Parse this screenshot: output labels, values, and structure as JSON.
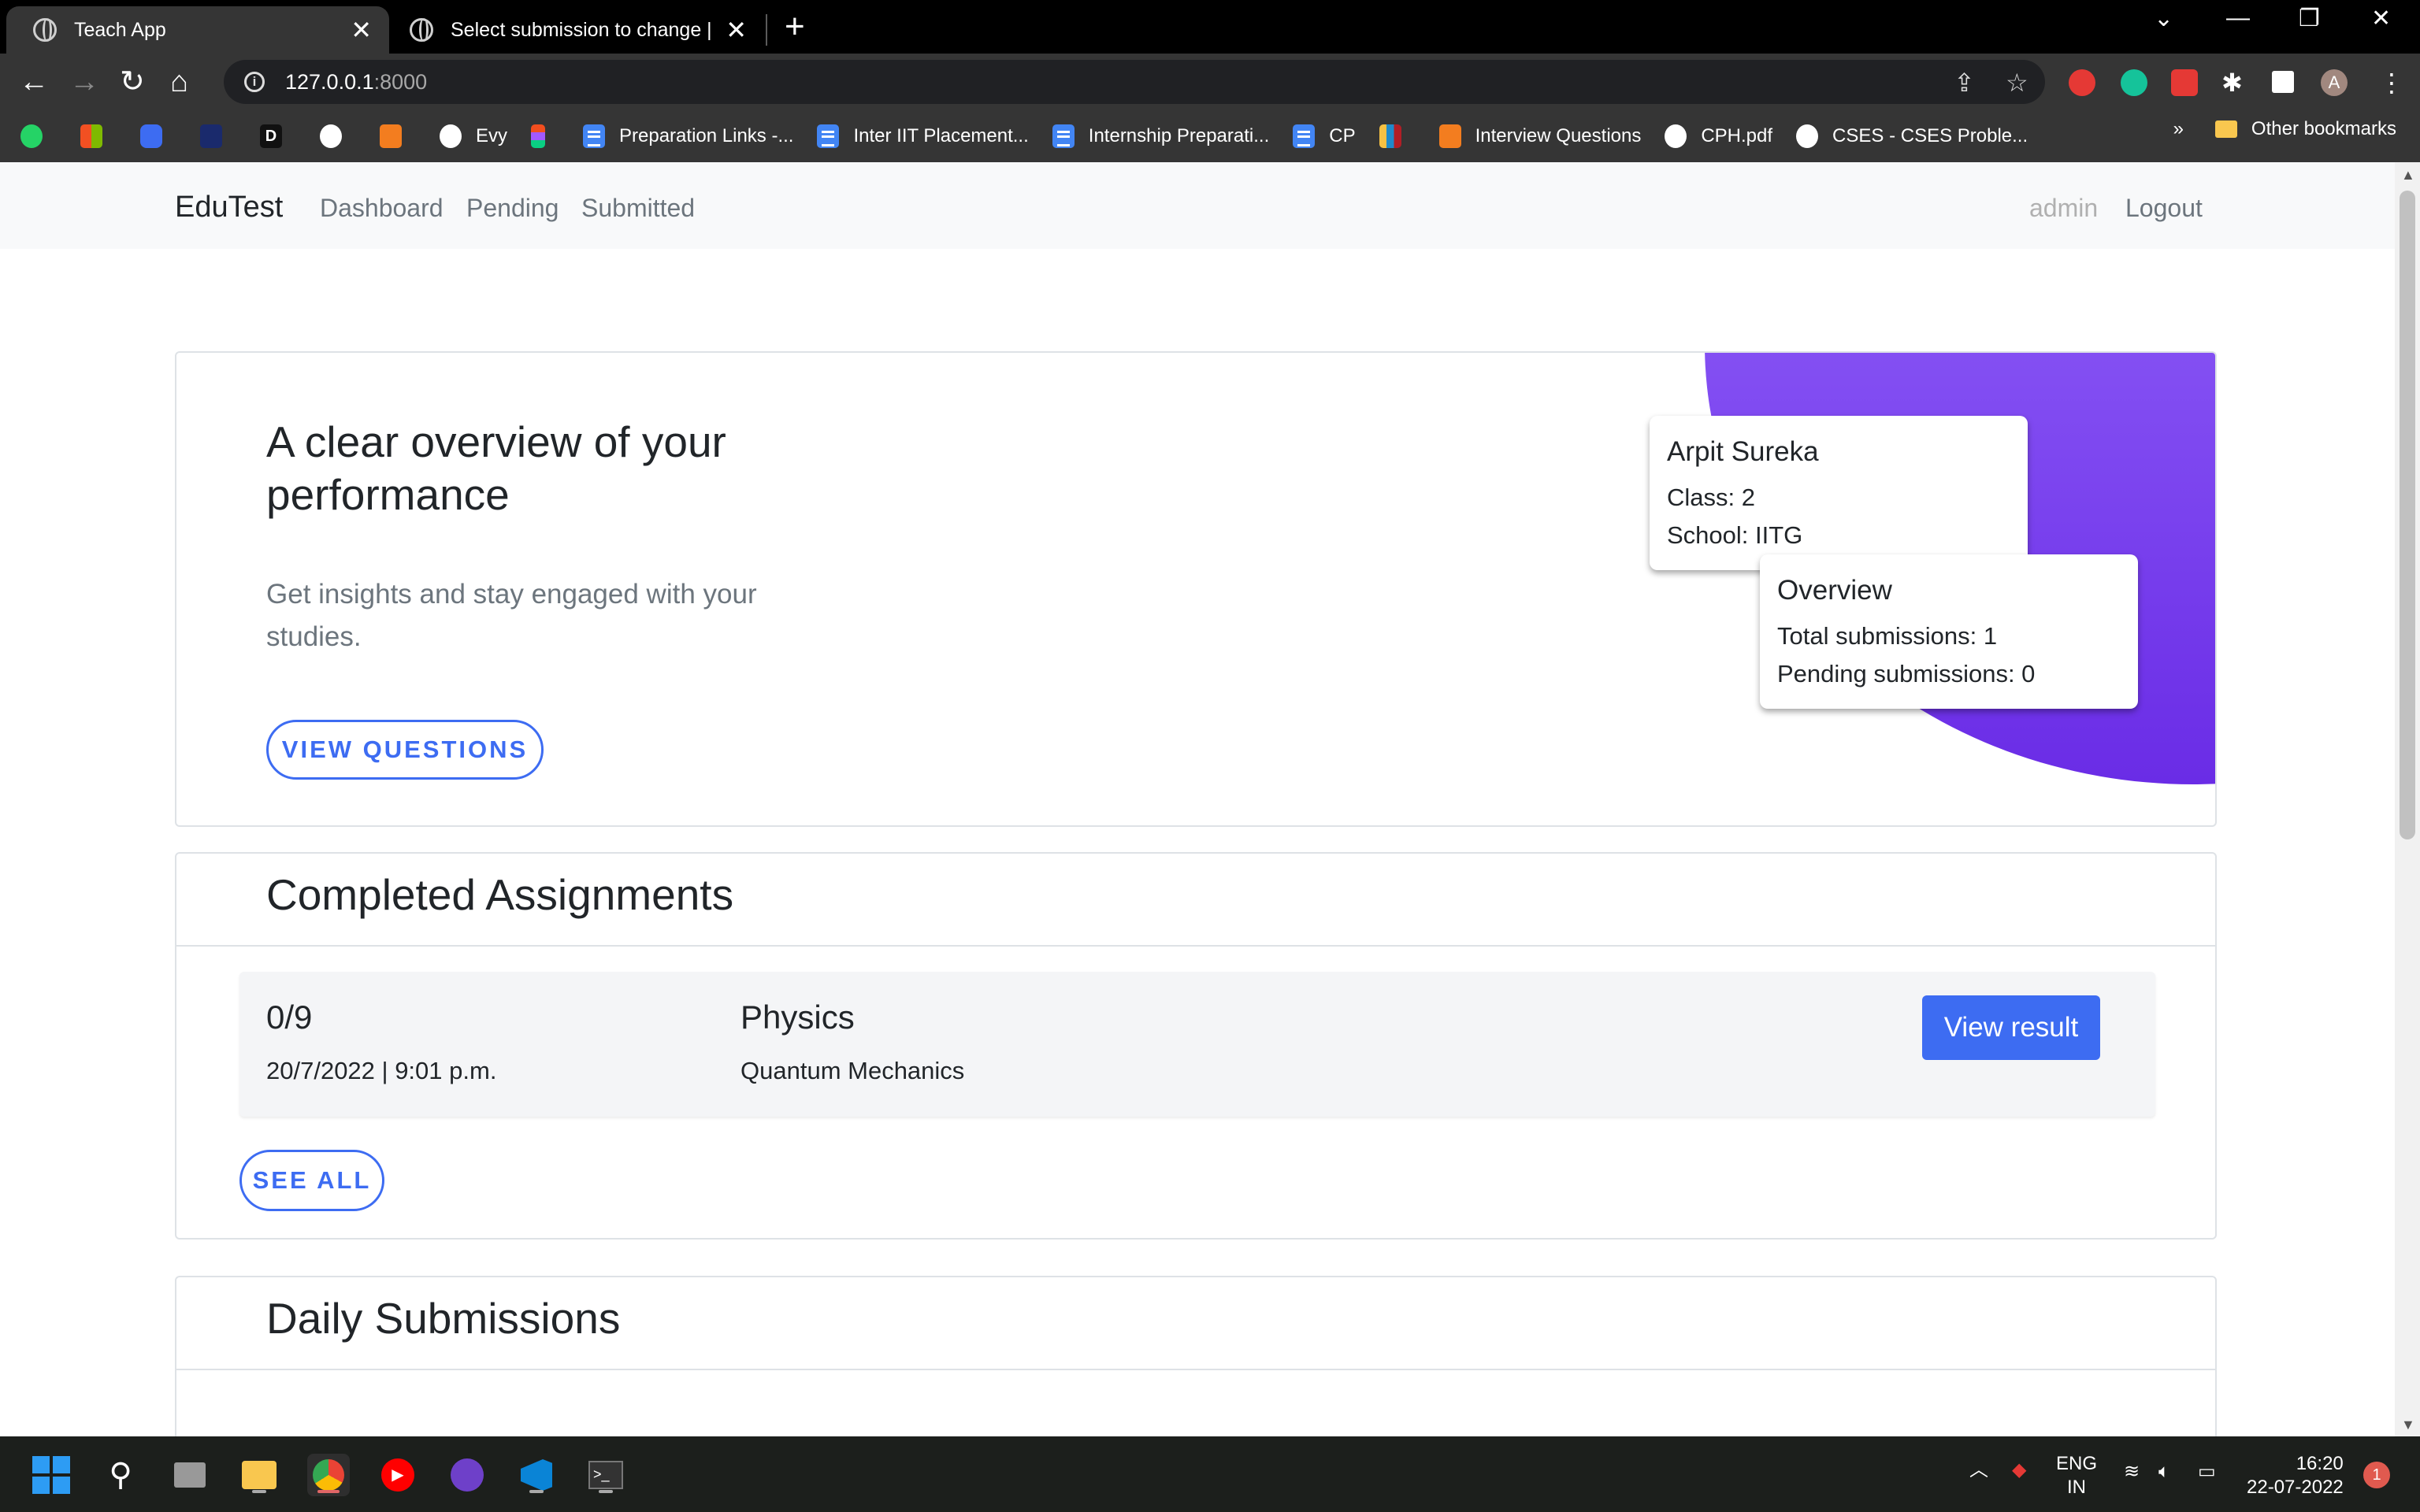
{
  "browser": {
    "tabs": [
      {
        "title": "Teach App",
        "active": true
      },
      {
        "title": "Select submission to change | Dja",
        "active": false
      }
    ],
    "url_host": "127.0.0.1",
    "url_port": ":8000",
    "bookmarks": [
      {
        "label": "",
        "icon": "gh"
      },
      {
        "label": "Evy",
        "icon": "gh"
      },
      {
        "label": "",
        "icon": "figma"
      },
      {
        "label": "Preparation Links -...",
        "icon": "doc"
      },
      {
        "label": "Inter IIT Placement...",
        "icon": "doc"
      },
      {
        "label": "Internship Preparati...",
        "icon": "doc"
      },
      {
        "label": "CP",
        "icon": "doc"
      },
      {
        "label": "",
        "icon": "codeforces"
      },
      {
        "label": "Interview Questions",
        "icon": "orange"
      },
      {
        "label": "CPH.pdf",
        "icon": "globe"
      },
      {
        "label": "CSES - CSES Proble...",
        "icon": "globe"
      }
    ],
    "bookmarks_overflow": "»",
    "other_bookmarks": "Other bookmarks",
    "profile_initial": "A"
  },
  "navbar": {
    "brand": "EduTest",
    "links": [
      "Dashboard",
      "Pending",
      "Submitted"
    ],
    "user": "admin",
    "logout": "Logout"
  },
  "hero": {
    "title": "A clear overview of your performance",
    "subtitle": "Get insights and stay engaged with your studies.",
    "button": "VIEW QUESTIONS",
    "profile": {
      "name": "Arpit Sureka",
      "class": "Class: 2",
      "school": "School: IITG"
    },
    "overview": {
      "title": "Overview",
      "total": "Total submissions: 1",
      "pending": "Pending submissions: 0"
    }
  },
  "completed": {
    "title": "Completed Assignments",
    "items": [
      {
        "score": "0/9",
        "date": "20/7/2022 | 9:01 p.m.",
        "subject": "Physics",
        "topic": "Quantum Mechanics",
        "button": "View result"
      }
    ],
    "see_all": "SEE ALL"
  },
  "daily": {
    "title": "Daily Submissions"
  },
  "taskbar": {
    "lang_top": "ENG",
    "lang_bottom": "IN",
    "time": "16:20",
    "date": "22-07-2022",
    "notification_count": "1"
  },
  "colors": {
    "accent": "#3d6cf2",
    "hero_gradient_top": "#a07ff7",
    "hero_gradient_bottom": "#6a2ce6"
  }
}
